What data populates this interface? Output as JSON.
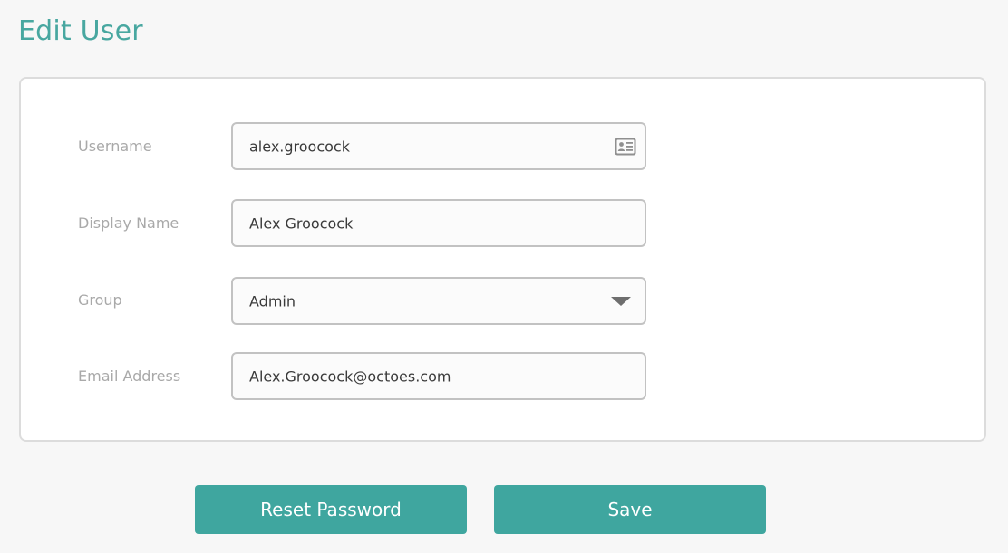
{
  "page": {
    "title": "Edit User"
  },
  "form": {
    "username": {
      "label": "Username",
      "value": "alex.groocock",
      "icon": "id-card-icon"
    },
    "display_name": {
      "label": "Display Name",
      "value": "Alex Groocock"
    },
    "group": {
      "label": "Group",
      "value": "Admin",
      "icon": "chevron-down-icon"
    },
    "email": {
      "label": "Email Address",
      "value": "Alex.Groocock@octoes.com"
    }
  },
  "actions": {
    "reset_password_label": "Reset Password",
    "save_label": "Save"
  },
  "colors": {
    "accent": "#3fa69f",
    "title": "#48a7a0",
    "label": "#a9a9a9",
    "background": "#f7f7f7"
  }
}
